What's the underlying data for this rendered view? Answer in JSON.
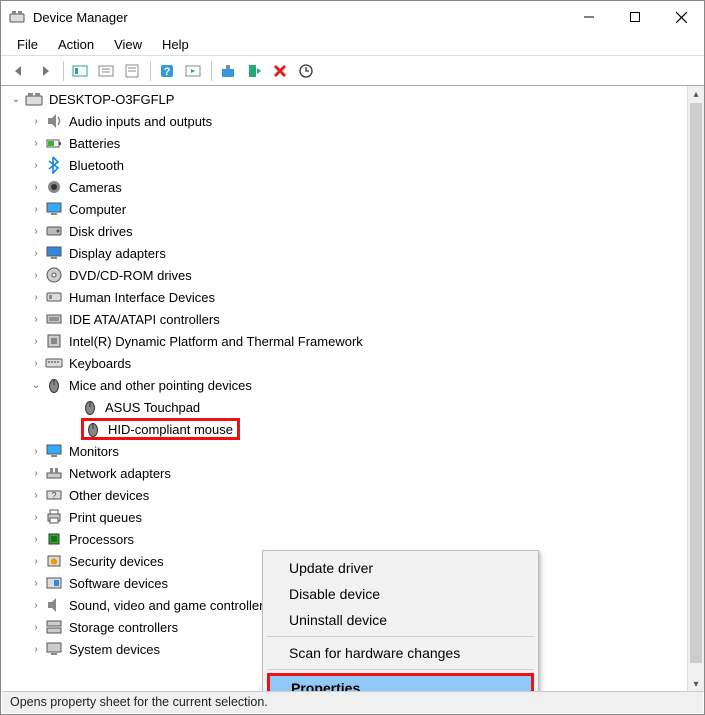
{
  "window": {
    "title": "Device Manager"
  },
  "menubar": {
    "items": [
      "File",
      "Action",
      "View",
      "Help"
    ]
  },
  "tree": {
    "root": {
      "label": "DESKTOP-O3FGFLP",
      "expanded": true
    },
    "categories": [
      {
        "label": "Audio inputs and outputs",
        "expanded": false
      },
      {
        "label": "Batteries",
        "expanded": false
      },
      {
        "label": "Bluetooth",
        "expanded": false
      },
      {
        "label": "Cameras",
        "expanded": false
      },
      {
        "label": "Computer",
        "expanded": false
      },
      {
        "label": "Disk drives",
        "expanded": false
      },
      {
        "label": "Display adapters",
        "expanded": false
      },
      {
        "label": "DVD/CD-ROM drives",
        "expanded": false
      },
      {
        "label": "Human Interface Devices",
        "expanded": false
      },
      {
        "label": "IDE ATA/ATAPI controllers",
        "expanded": false
      },
      {
        "label": "Intel(R) Dynamic Platform and Thermal Framework",
        "expanded": false
      },
      {
        "label": "Keyboards",
        "expanded": false
      },
      {
        "label": "Mice and other pointing devices",
        "expanded": true,
        "children": [
          {
            "label": "ASUS Touchpad"
          },
          {
            "label": "HID-compliant mouse",
            "highlight": true
          }
        ]
      },
      {
        "label": "Monitors",
        "expanded": false
      },
      {
        "label": "Network adapters",
        "expanded": false
      },
      {
        "label": "Other devices",
        "expanded": false
      },
      {
        "label": "Print queues",
        "expanded": false
      },
      {
        "label": "Processors",
        "expanded": false
      },
      {
        "label": "Security devices",
        "expanded": false
      },
      {
        "label": "Software devices",
        "expanded": false
      },
      {
        "label": "Sound, video and game controllers",
        "expanded": false
      },
      {
        "label": "Storage controllers",
        "expanded": false
      },
      {
        "label": "System devices",
        "expanded": false
      }
    ]
  },
  "contextmenu": {
    "items": [
      "Update driver",
      "Disable device",
      "Uninstall device"
    ],
    "items2": [
      "Scan for hardware changes"
    ],
    "highlight": "Properties"
  },
  "statusbar": {
    "text": "Opens property sheet for the current selection."
  }
}
